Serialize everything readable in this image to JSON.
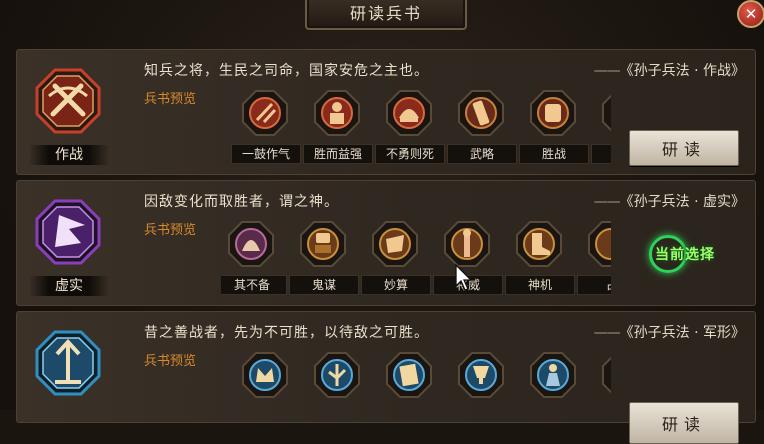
{
  "window": {
    "title": "研读兵书",
    "close_glyph": "✕"
  },
  "rows": [
    {
      "name": "作战",
      "quote": "知兵之将，生民之司命，国家安危之主也。",
      "source_dash": "——",
      "source": "《孙子兵法 · 作战》",
      "preview_label": "兵书预览",
      "emblem_color": "#c8402a",
      "skills": [
        "一鼓作气",
        "胜而益强",
        "不勇则死",
        "武略",
        "胜战",
        ""
      ],
      "action": "研读"
    },
    {
      "name": "虚实",
      "quote": "因敌变化而取胜者，谓之神。",
      "source_dash": "——",
      "source": "《孙子兵法 · 虚实》",
      "preview_label": "兵书预览",
      "emblem_color": "#8a3fb8",
      "skills": [
        "其不备",
        "鬼谋",
        "妙算",
        "将威",
        "神机",
        "占"
      ],
      "status": "当前选择"
    },
    {
      "name": "",
      "quote": "昔之善战者，先为不可胜，以待敌之可胜。",
      "source_dash": "——",
      "source": "《孙子兵法 · 军形》",
      "preview_label": "兵书预览",
      "emblem_color": "#2f8fc0",
      "skills": [
        "",
        "",
        "",
        "",
        "",
        ""
      ],
      "action": "研读"
    }
  ],
  "icons": {
    "row0": [
      "drum-icon",
      "warrior-icon",
      "helmet-icon",
      "scroll-icon",
      "fist-icon",
      "banner-icon"
    ],
    "row1": [
      "fan-icon",
      "mask-icon",
      "hand-icon",
      "general-icon",
      "boot-icon",
      "shield-icon"
    ],
    "row2": [
      "crown-icon",
      "tree-icon",
      "book-icon",
      "cup-icon",
      "statue-icon",
      "tower-icon"
    ]
  }
}
